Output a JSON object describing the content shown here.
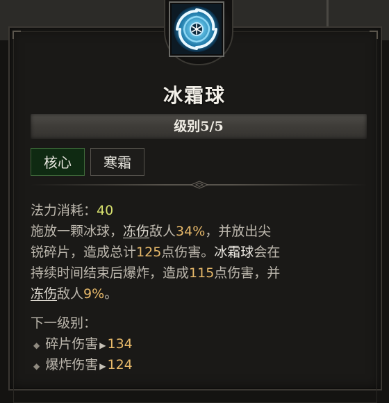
{
  "skill": {
    "icon": "frost-orb-icon",
    "name": "冰霜球",
    "level_label": "级别5/5",
    "tags": [
      "核心",
      "寒霜"
    ]
  },
  "description": {
    "cost_label": "法力消耗：",
    "cost_value": "40",
    "l1_a": "施放一颗冰球，",
    "l1_frozen": "冻伤",
    "l1_b": "敌人",
    "l1_pct": "34%",
    "l1_c": "，并放出尖",
    "l2_a": "锐碎片，造成总计",
    "l2_num": "125",
    "l2_b": "点伤害。",
    "l2_skill": "冰霜球",
    "l2_c": "会在",
    "l3_a": "持续时间结束后爆炸，造成",
    "l3_num": "115",
    "l3_b": "点伤害，并",
    "l4_frozen": "冻伤",
    "l4_a": "敌人",
    "l4_pct": "9%",
    "l4_b": "。"
  },
  "next_level": {
    "label": "下一级别：",
    "items": [
      {
        "name": "碎片伤害",
        "value": "134"
      },
      {
        "name": "爆炸伤害",
        "value": "124"
      }
    ]
  },
  "colors": {
    "core_tag_bg": "#0f2a12",
    "number_highlight": "#e7b96a",
    "mana_value": "#d7e06e",
    "icon_glow": "#2aa9e0"
  }
}
